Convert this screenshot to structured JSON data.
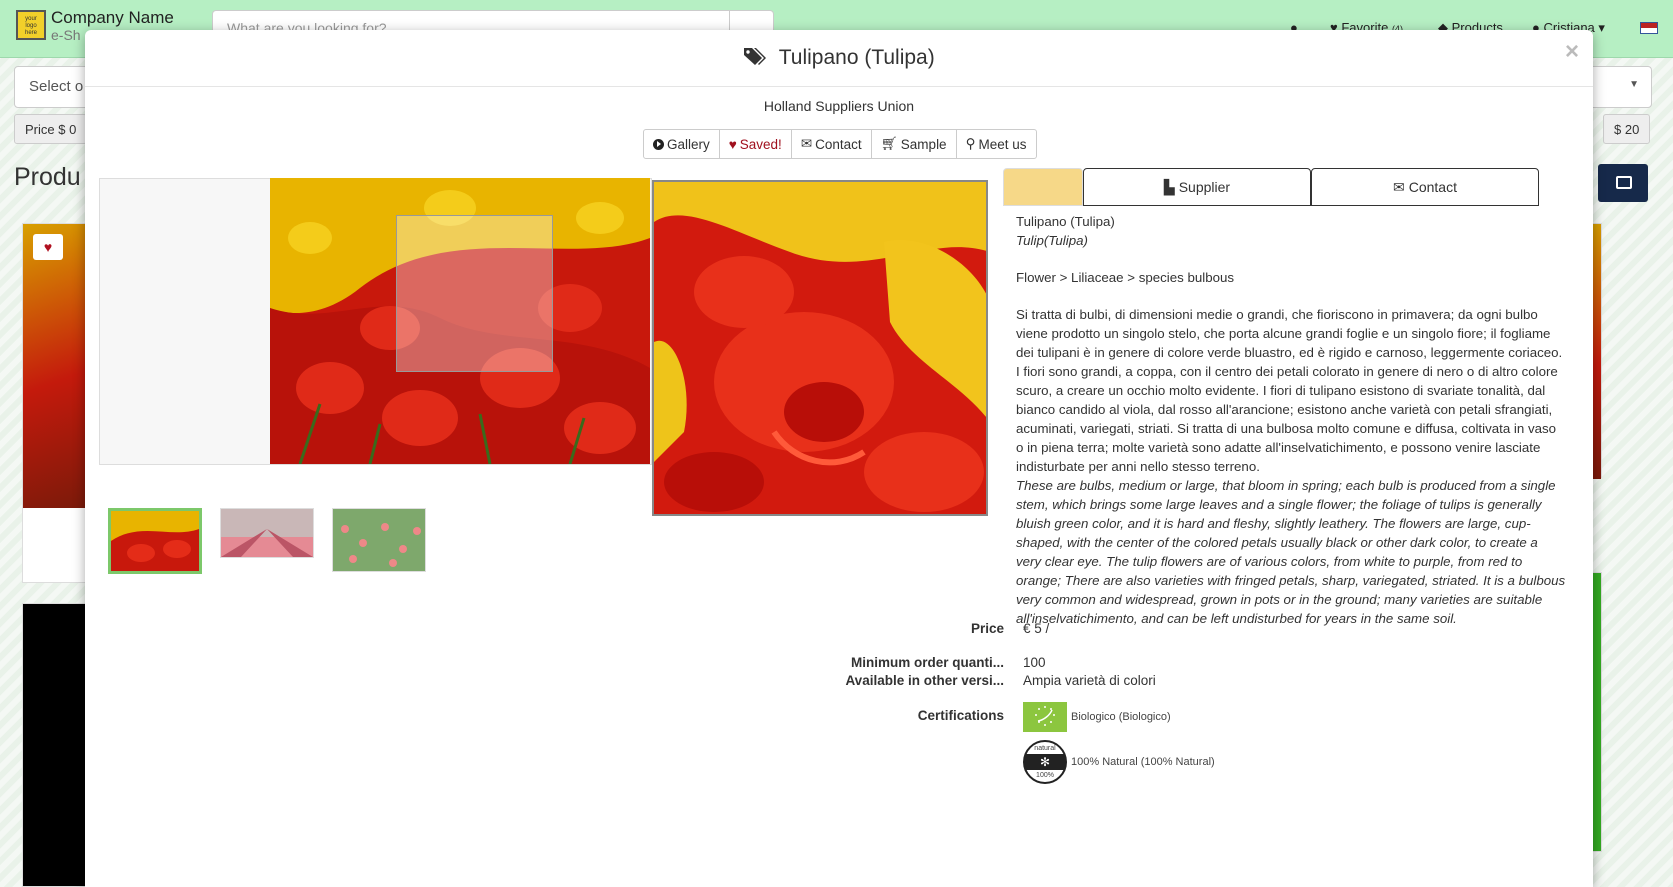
{
  "header": {
    "logo_text": "your logo here",
    "brand_name": "Company Name",
    "brand_sub": "e-Sh",
    "search_placeholder": "What are you looking for?",
    "favorites_label": "Favorite",
    "favorites_count": "(4)",
    "products_label": "Products",
    "user_label": "Cristiana"
  },
  "background": {
    "select_placeholder": "Select o",
    "price_min_label": "Price $ 0",
    "price_max_label": "$ 20",
    "products_heading": "Produ"
  },
  "modal": {
    "title": "Tulipano (Tulipa)",
    "supplier": "Holland Suppliers Union",
    "buttons": {
      "gallery": "Gallery",
      "saved": "Saved!",
      "contact": "Contact",
      "sample": "Sample",
      "meet_us": "Meet us"
    },
    "tabs": {
      "supplier": "Supplier",
      "contact": "Contact"
    },
    "product": {
      "name_it": "Tulipano (Tulipa)",
      "name_en": "Tulip(Tulipa)",
      "category": "Flower > Liliaceae > species bulbous",
      "description_it": "Si tratta di bulbi, di dimensioni medie o grandi, che fioriscono in primavera; da ogni bulbo viene prodotto un singolo stelo, che porta alcune grandi foglie e un singolo fiore; il fogliame dei tulipani è in genere di colore verde bluastro, ed è rigido e carnoso, leggermente coriaceo. I fiori sono grandi, a coppa, con il centro dei petali colorato in genere di nero o di altro colore scuro, a creare un occhio molto evidente. I fiori di tulipano esistono di svariate tonalità, dal bianco candido al viola, dal rosso all'arancione; esistono anche varietà con petali sfrangiati, acuminati, variegati, striati. Si tratta di una bulbosa molto comune e diffusa, coltivata in vaso o in piena terra; molte varietà sono adatte all'inselvatichimento, e possono venire lasciate indisturbate per anni nello stesso terreno.",
      "description_en": "These are bulbs, medium or large, that bloom in spring; each bulb is produced from a single stem, which brings some large leaves and a single flower; the foliage of tulips is generally bluish green color, and it is hard and fleshy, slightly leathery. The flowers are large, cup-shaped, with the center of the colored petals usually black or other dark color, to create a very clear eye. The tulip flowers are of various colors, from white to purple, from red to orange; There are also varieties with fringed petals, sharp, variegated, striated. It is a bulbous very common and widespread, grown in pots or in the ground; many varieties are suitable all'inselvatichimento, and can be left undisturbed for years in the same soil."
    },
    "details": {
      "price_label": "Price",
      "price_value": "€ 5 /",
      "min_order_label": "Minimum order quanti...",
      "min_order_value": "100",
      "other_versions_label": "Available in other versi...",
      "other_versions_value": "Ampia varietà di colori",
      "certifications_label": "Certifications",
      "cert_1": "Biologico (Biologico)",
      "cert_2": "100% Natural (100% Natural)",
      "cert_2_badge_top": "natural",
      "cert_2_badge_bottom": "100%"
    }
  },
  "colors": {
    "topbar": "#b6efc3",
    "saved_red": "#a0101e",
    "active_tab": "#f6d888",
    "organic_green": "#8cc63f"
  }
}
